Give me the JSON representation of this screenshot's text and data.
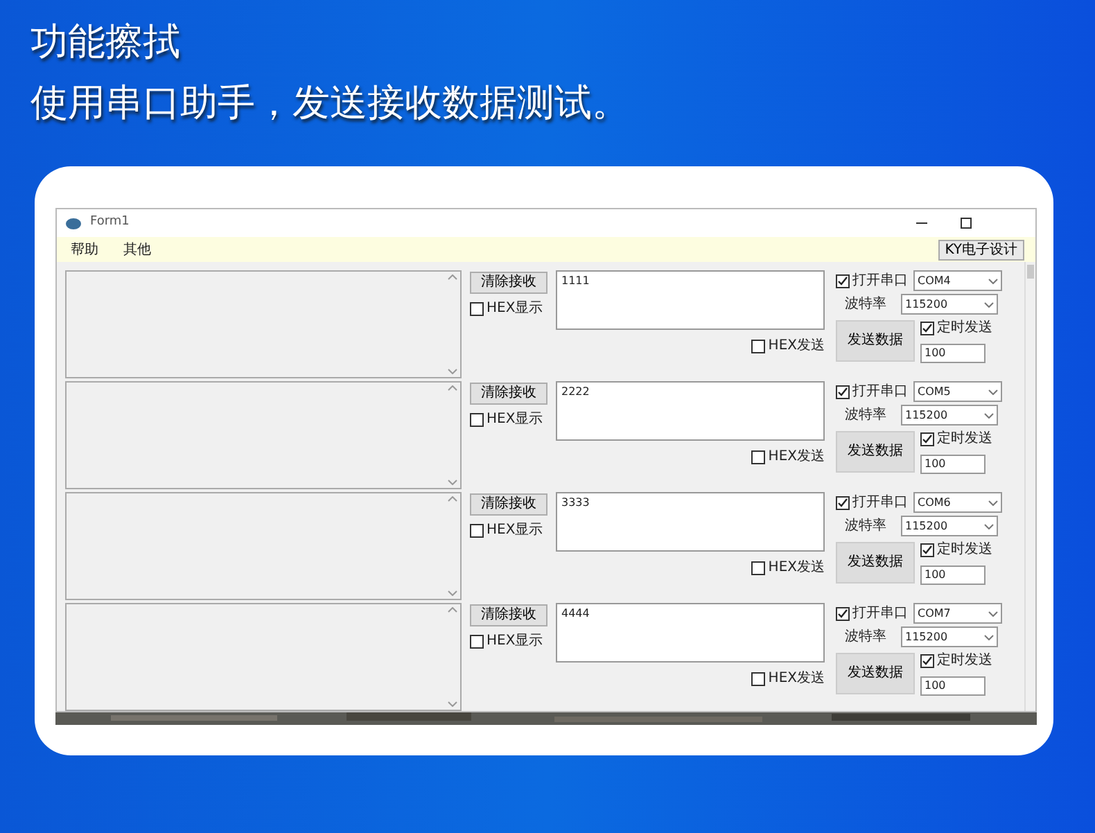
{
  "heading": {
    "title": "功能擦拭",
    "subtitle": "使用串口助手，发送接收数据测试。"
  },
  "window": {
    "title": "Form1",
    "menu": [
      "帮助",
      "其他"
    ],
    "menu_button": "KY电子设计"
  },
  "panels": [
    {
      "clear_button": "清除接收",
      "hex_display": {
        "label": "HEX显示",
        "checked": false
      },
      "send_text": "1111",
      "hex_send": {
        "label": "HEX发送",
        "checked": false
      },
      "open_port": {
        "label": "打开串口",
        "checked": true
      },
      "port": "COM4",
      "baud_label": "波特率",
      "baud": "115200",
      "send_button": "发送数据",
      "timed_send": {
        "label": "定时发送",
        "checked": true
      },
      "interval": "100"
    },
    {
      "clear_button": "清除接收",
      "hex_display": {
        "label": "HEX显示",
        "checked": false
      },
      "send_text": "2222",
      "hex_send": {
        "label": "HEX发送",
        "checked": false
      },
      "open_port": {
        "label": "打开串口",
        "checked": true
      },
      "port": "COM5",
      "baud_label": "波特率",
      "baud": "115200",
      "send_button": "发送数据",
      "timed_send": {
        "label": "定时发送",
        "checked": true
      },
      "interval": "100"
    },
    {
      "clear_button": "清除接收",
      "hex_display": {
        "label": "HEX显示",
        "checked": false
      },
      "send_text": "3333",
      "hex_send": {
        "label": "HEX发送",
        "checked": false
      },
      "open_port": {
        "label": "打开串口",
        "checked": true
      },
      "port": "COM6",
      "baud_label": "波特率",
      "baud": "115200",
      "send_button": "发送数据",
      "timed_send": {
        "label": "定时发送",
        "checked": true
      },
      "interval": "100"
    },
    {
      "clear_button": "清除接收",
      "hex_display": {
        "label": "HEX显示",
        "checked": false
      },
      "send_text": "4444",
      "hex_send": {
        "label": "HEX发送",
        "checked": false
      },
      "open_port": {
        "label": "打开串口",
        "checked": true
      },
      "port": "COM7",
      "baud_label": "波特率",
      "baud": "115200",
      "send_button": "发送数据",
      "timed_send": {
        "label": "定时发送",
        "checked": true
      },
      "interval": "100"
    }
  ]
}
